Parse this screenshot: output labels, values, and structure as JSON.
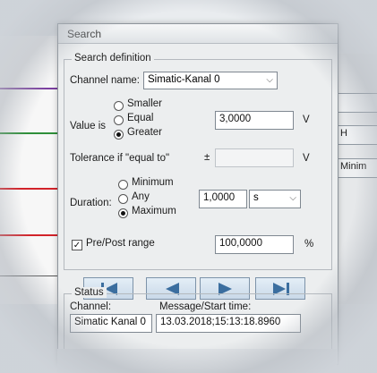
{
  "dialog": {
    "title": "Search"
  },
  "search_definition": {
    "group_label": "Search definition",
    "channel_name_label": "Channel name:",
    "channel_name_value": "Simatic-Kanal 0",
    "value_is_label": "Value is",
    "value_options": [
      "Smaller",
      "Equal",
      "Greater"
    ],
    "value_selected": "Greater",
    "value": "3,0000",
    "value_unit": "V",
    "tolerance_label": "Tolerance if \"equal to\"",
    "tolerance_symbol": "±",
    "tolerance_value": "",
    "tolerance_unit": "V",
    "duration_label": "Duration:",
    "duration_options": [
      "Minimum",
      "Any",
      "Maximum"
    ],
    "duration_selected": "Maximum",
    "duration_value": "1,0000",
    "duration_unit": "s",
    "pre_post_label": "Pre/Post range",
    "pre_post_checked": true,
    "pre_post_value": "100,0000",
    "pre_post_unit": "%"
  },
  "navigation": {
    "buttons": [
      "first-icon",
      "previous-icon",
      "next-icon",
      "last-icon"
    ]
  },
  "status": {
    "group_label": "Status",
    "channel_label": "Channel:",
    "message_label": "Message/Start time:",
    "channel_value": "Simatic Kanal 0",
    "message_value": "13.03.2018;15:13:18.8960"
  },
  "side_panel": {
    "buttons": [
      "",
      "H",
      "Minim"
    ]
  },
  "colors": {
    "nav_arrow": "#3b6e9f",
    "trace_red": "#d2232a",
    "trace_green": "#2f8f3a",
    "trace_purple": "#7b3fa0"
  }
}
